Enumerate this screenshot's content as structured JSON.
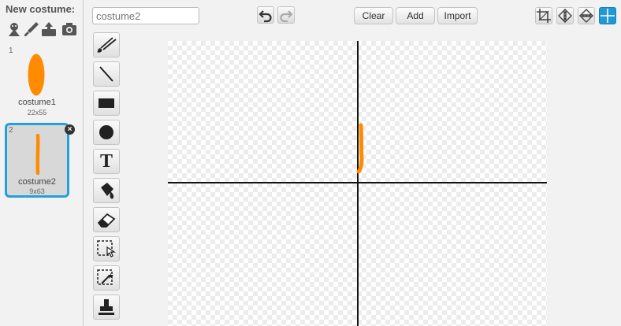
{
  "costume_panel": {
    "title": "New costume:",
    "new_costume_icons": [
      "sprite-library-icon",
      "paint-brush-icon",
      "upload-icon",
      "camera-icon"
    ],
    "costumes": [
      {
        "number": "1",
        "name": "costume1",
        "size": "22x55",
        "color": "#ff8c00",
        "selected": false
      },
      {
        "number": "2",
        "name": "costume2",
        "size": "9x63",
        "color": "#ff8c00",
        "selected": true
      }
    ],
    "delete_glyph": "×"
  },
  "editor": {
    "costume_name_placeholder": "costume2",
    "buttons": {
      "clear": "Clear",
      "add": "Add",
      "import": "Import"
    },
    "history_icons": [
      "undo-icon",
      "redo-icon"
    ],
    "view_tools": [
      "crop-icon",
      "flip-horizontal-icon",
      "flip-vertical-icon",
      "set-center-icon"
    ],
    "tools": [
      "paintbrush-icon",
      "line-icon",
      "rectangle-icon",
      "ellipse-icon",
      "text-icon",
      "fill-bucket-icon",
      "eraser-icon",
      "select-icon",
      "select-remove-background-icon",
      "stamp-icon"
    ],
    "text_tool_glyph": "T"
  },
  "colors": {
    "selection_accent": "#26a0da",
    "shape_fill": "#ff8c00",
    "active_tool": "#2098d6"
  }
}
